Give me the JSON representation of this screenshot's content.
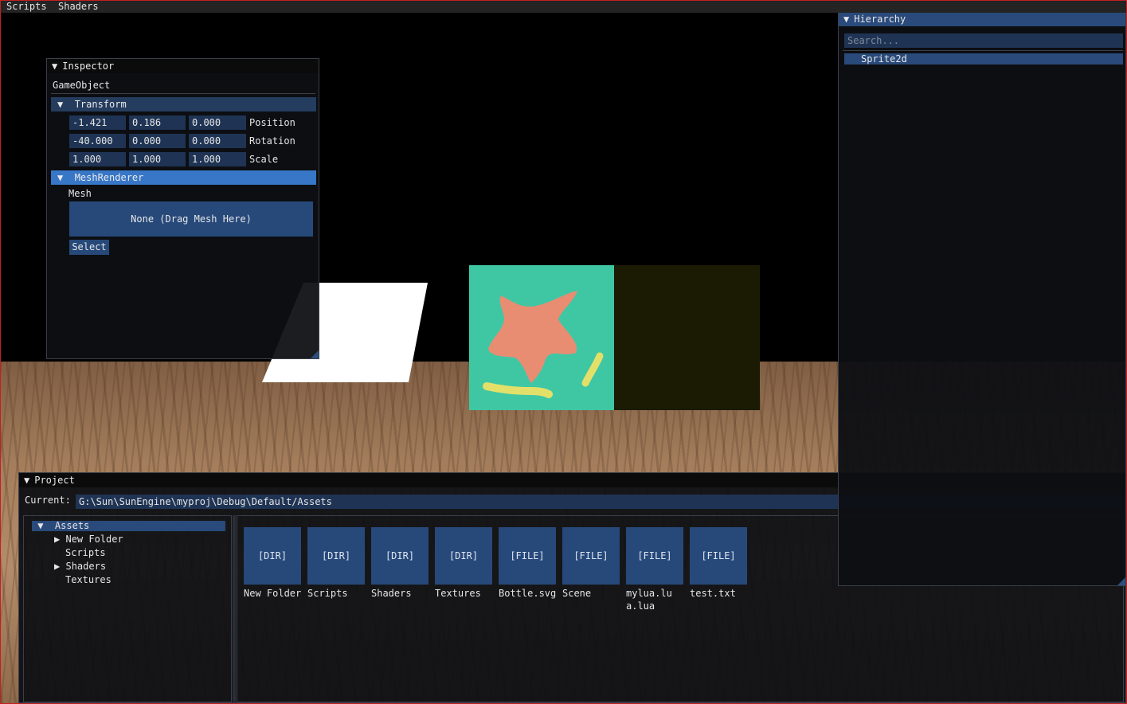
{
  "menu": {
    "items": [
      "Scripts",
      "Shaders"
    ]
  },
  "inspector": {
    "title": "Inspector",
    "object_name": "GameObject",
    "transform": {
      "header": "Transform",
      "position": {
        "x": "-1.421",
        "y": "0.186",
        "z": "0.000",
        "label": "Position"
      },
      "rotation": {
        "x": "-40.000",
        "y": "0.000",
        "z": "0.000",
        "label": "Rotation"
      },
      "scale": {
        "x": "1.000",
        "y": "1.000",
        "z": "1.000",
        "label": "Scale"
      }
    },
    "mesh_renderer": {
      "header": "MeshRenderer",
      "mesh_label": "Mesh",
      "drop_target": "None (Drag Mesh Here)",
      "select_label": "Select"
    }
  },
  "hierarchy": {
    "title": "Hierarchy",
    "search_placeholder": "Search...",
    "items": [
      "Sprite2d"
    ]
  },
  "project": {
    "title": "Project",
    "current_label": "Current:",
    "current_path": "G:\\Sun\\SunEngine\\myproj\\Debug\\Default/Assets",
    "tree": {
      "root": "Assets",
      "children": [
        {
          "name": "New Folder",
          "has_children": true
        },
        {
          "name": "Scripts",
          "has_children": false
        },
        {
          "name": "Shaders",
          "has_children": true
        },
        {
          "name": "Textures",
          "has_children": false
        }
      ]
    },
    "assets": [
      {
        "tag": "[DIR]",
        "name": "New Folder"
      },
      {
        "tag": "[DIR]",
        "name": "Scripts"
      },
      {
        "tag": "[DIR]",
        "name": "Shaders"
      },
      {
        "tag": "[DIR]",
        "name": "Textures"
      },
      {
        "tag": "[FILE]",
        "name": "Bottle.svg"
      },
      {
        "tag": "[FILE]",
        "name": "Scene"
      },
      {
        "tag": "[FILE]",
        "name": "mylua.lua.lua"
      },
      {
        "tag": "[FILE]",
        "name": "test.txt"
      }
    ]
  },
  "colors": {
    "accent": "#294a7a",
    "header_active": "#3877c7",
    "frame_border": "#c42020",
    "sprite_bg": "#3fc7a4",
    "sprite_star": "#e88d72",
    "sprite_stroke": "#e3e06a"
  }
}
